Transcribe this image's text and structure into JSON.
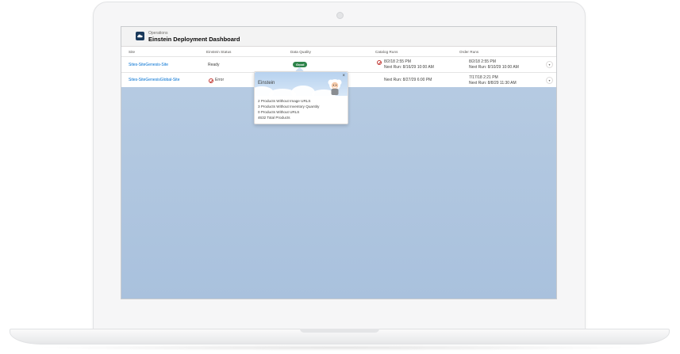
{
  "header": {
    "subtitle": "Operations",
    "title": "Einstein Deployment Dashboard"
  },
  "columns": [
    "Site",
    "Einstein Status",
    "Data Quality",
    "Catalog Runs",
    "Order Runs"
  ],
  "rows": [
    {
      "site": "Sites-SiteGenesis-Site",
      "status": "Ready",
      "quality": "Good",
      "catalog_last": "8/2/18 2:55 PM",
      "catalog_next": "Next Run: 8/16/29 10:00 AM",
      "order_last": "8/2/18 2:55 PM",
      "order_next": "Next Run: 8/10/29 10:00 AM"
    },
    {
      "site": "Sites-SiteGenesisGlobal-Site",
      "status": "Error",
      "catalog_next": "Next Run: 8/27/29 6:00 PM",
      "order_last": "7/17/18 2:21 PM",
      "order_next": "Next Run: 8/8/29 11:30 AM"
    }
  ],
  "popover": {
    "title": "Einstein",
    "close_glyph": "×",
    "lines": [
      "2 Products Without Image URLS",
      "3 Products Without Inventory Quantity",
      "0 Products Without URLS",
      "4632 Total Products"
    ]
  },
  "row_menu_glyph": "▾",
  "icons": {
    "app": "cloud-app-icon",
    "error": "error-icon",
    "close": "close-icon",
    "menu": "chevron-down-icon"
  },
  "colors": {
    "link": "#0070d2",
    "good_badge": "#2e844a",
    "error": "#c23934",
    "screen_bg": "#b0c6df"
  }
}
